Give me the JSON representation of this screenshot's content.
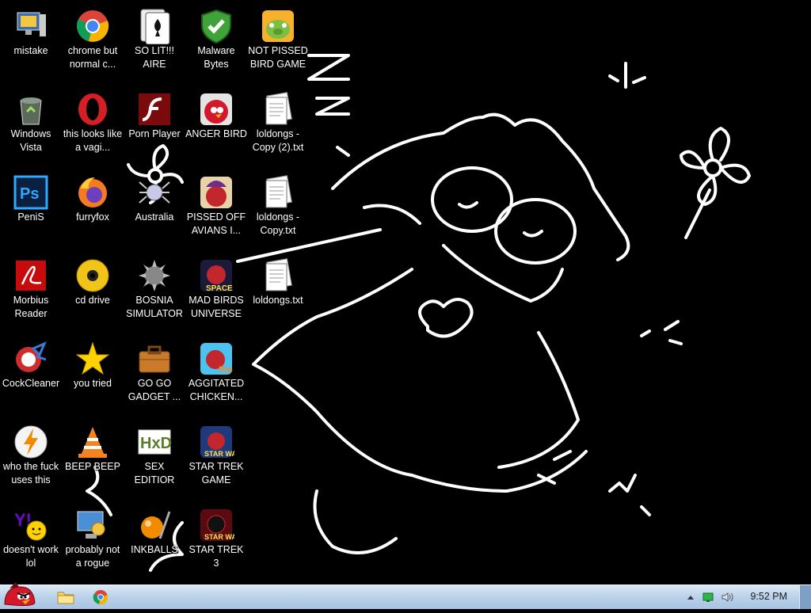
{
  "desktop": {
    "icons": [
      {
        "id": "mistake",
        "label": "mistake",
        "icon": "computer-icon"
      },
      {
        "id": "chrome",
        "label": "chrome but normal c...",
        "icon": "chrome-icon"
      },
      {
        "id": "solitaire",
        "label": "SO LIT!!! AIRE",
        "icon": "solitaire-icon"
      },
      {
        "id": "malwarebytes",
        "label": "Malware Bytes",
        "icon": "shield-icon"
      },
      {
        "id": "not-pissed",
        "label": "NOT PISSED BIRD GAME",
        "icon": "green-pig-icon"
      },
      {
        "id": "recycle",
        "label": "Windows Vista",
        "icon": "recycle-bin-icon"
      },
      {
        "id": "opera",
        "label": "this looks like a vagi...",
        "icon": "opera-icon"
      },
      {
        "id": "flash",
        "label": "Porn Player",
        "icon": "flash-icon"
      },
      {
        "id": "anger-bird",
        "label": "ANGER BIRD",
        "icon": "angry-bird-icon"
      },
      {
        "id": "loldongs2",
        "label": "loldongs - Copy (2).txt",
        "icon": "text-file-icon"
      },
      {
        "id": "photoshop",
        "label": "PeniS",
        "icon": "photoshop-icon"
      },
      {
        "id": "firefox",
        "label": "furryfox",
        "icon": "firefox-icon"
      },
      {
        "id": "australia",
        "label": "Australia",
        "icon": "spider-icon"
      },
      {
        "id": "pissed-off",
        "label": "PISSED OFF AVIANS I...",
        "icon": "angry-birds-seasons-icon"
      },
      {
        "id": "loldongs1",
        "label": "loldongs - Copy.txt",
        "icon": "text-file-icon"
      },
      {
        "id": "morbius",
        "label": "Morbius Reader",
        "icon": "pdf-icon"
      },
      {
        "id": "cd-drive",
        "label": "cd drive",
        "icon": "cd-icon"
      },
      {
        "id": "bosnia",
        "label": "BOSNIA SIMULATOR",
        "icon": "spiked-ball-icon"
      },
      {
        "id": "mad-birds",
        "label": "MAD BIRDS UNIVERSE",
        "icon": "angry-birds-space-icon"
      },
      {
        "id": "loldongs",
        "label": "loldongs.txt",
        "icon": "text-file-icon"
      },
      {
        "id": "ccleaner",
        "label": "CockCleaner",
        "icon": "ccleaner-icon"
      },
      {
        "id": "you-tried",
        "label": "you tried",
        "icon": "star-icon"
      },
      {
        "id": "gadget",
        "label": "GO GO GADGET ...",
        "icon": "briefcase-icon"
      },
      {
        "id": "agitated",
        "label": "AGGITATED CHICKEN...",
        "icon": "angry-birds-rio-icon"
      },
      {
        "id": "winamp",
        "label": "who the fuck uses this",
        "icon": "winamp-icon"
      },
      {
        "id": "vlc",
        "label": "BEEP BEEP",
        "icon": "vlc-cone-icon"
      },
      {
        "id": "hxd",
        "label": "SEX EDITIOR",
        "icon": "hxd-icon"
      },
      {
        "id": "startrek",
        "label": "STAR TREK GAME",
        "icon": "angry-birds-star-wars-icon"
      },
      {
        "id": "yahoo",
        "label": "doesn't work lol",
        "icon": "yahoo-messenger-icon"
      },
      {
        "id": "rogue",
        "label": "probably not a rogue",
        "icon": "control-panel-icon"
      },
      {
        "id": "inkballs",
        "label": "INKBALLS",
        "icon": "inkball-icon"
      },
      {
        "id": "startrek3",
        "label": "STAR TREK 3",
        "icon": "angry-birds-star-wars-2-icon"
      }
    ]
  },
  "taskbar": {
    "start": {
      "icon": "angry-bird-start-icon"
    },
    "pinned": [
      {
        "icon": "folder-icon"
      },
      {
        "icon": "chrome-icon"
      }
    ],
    "tray": [
      {
        "icon": "chevron-up-icon"
      },
      {
        "icon": "network-icon"
      },
      {
        "icon": "volume-icon"
      }
    ],
    "clock": "9:52 PM"
  }
}
